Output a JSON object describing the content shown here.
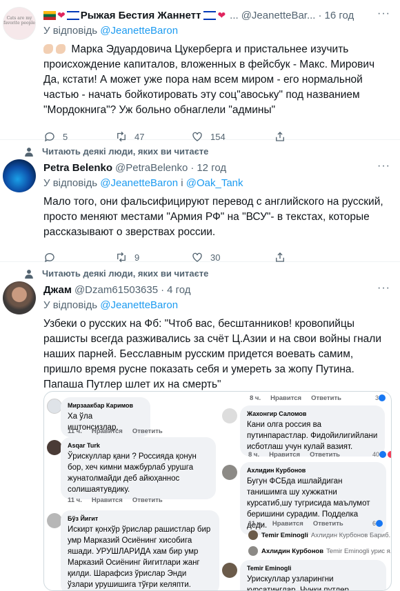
{
  "tweets": [
    {
      "name": "Рыжая Бестия Жаннетт",
      "handle": "@JeanetteBar...",
      "time": "16 год",
      "reply_prefix": "У відповідь",
      "reply_to": "@JeanetteBaron",
      "text": "Марка Эдуардовича Цукерберга и пристальнее изучить происхождение капиталов, вложенных в фейсбук - Макс. Мирович Да, кстати! А может уже пора нам всем миром - его нормальной частью - начать бойкотировать эту соц\"авоську\" под названием \"Мордокнига\"? Уж больно обнаглели \"админы\"",
      "replies": "5",
      "retweets": "47",
      "likes": "154",
      "avatar_text": "Cats are my favorite people"
    },
    {
      "social": "Читають деякі люди, яких ви читаєте",
      "name": "Petra Belenko",
      "handle": "@PetraBelenko",
      "time": "12 год",
      "reply_prefix": "У відповідь",
      "reply_to": "@JeanetteBaron",
      "reply_and": "і",
      "reply_to2": "@Oak_Tank",
      "text": "Мало того, они фальсифицируют перевод с английского на русский, просто меняют местами \"Армия РФ\" на \"ВСУ\"- в текстах, которые рассказывают о зверствах россии.",
      "replies": "",
      "retweets": "9",
      "likes": "30"
    },
    {
      "social": "Читають деякі люди, яких ви читаєте",
      "name": "Джам",
      "handle": "@Dzam61503635",
      "time": "4 год",
      "reply_prefix": "У відповідь",
      "reply_to": "@JeanetteBaron",
      "text": "Узбеки о русских на Фб: \"Чтоб вас, бесштанников!  кровопийцы рашисты всегда разживались за счёт Ц.Азии и на свои войны гнали наших парней. Бесславным русским придется воевать самим, пришло время русне показать себя и умереть за жопу Путина. Папаша Путлер шлет их на смерть\""
    }
  ],
  "media": {
    "left": [
      {
        "author": "Мирзаакбар Каримов",
        "text": "Ха ўла иштонсизлар.",
        "age": "11 ч.",
        "like": "Нравится",
        "reply": "Ответить"
      },
      {
        "author": "Asqar Turk",
        "text": "Ўрискуллар қани ? Россияда қонун бор, хеч кимни мажбурлаб урушга жунатолмайди деб айюҳаннос солишаятувдику.",
        "age": "11 ч.",
        "like": "Нравится",
        "reply": "Ответить"
      },
      {
        "author": "Бўз Йигит",
        "text": "Искирт қонхўр ўрислар рашистлар бир умр Марказий Осиёнинг хисобига яшади.  УРУШЛАРИДА  хам бир умр Марказий Осиёнинг йигитлари жанг қилди.  Шарафсиз ўрислар Энди ўзлари урушишига тўғри келяпти."
      }
    ],
    "right": [
      {
        "age": "8 ч.",
        "like": "Нравится",
        "reply": "Ответить",
        "count": "3"
      },
      {
        "author": "Жахонгир Саломов",
        "text": "Кани олга россия ва путинпарастлар. Фидойилигийлани исботлаш учун кулай вазият.",
        "age": "8 ч.",
        "like": "Нравится",
        "reply": "Ответить",
        "count": "40"
      },
      {
        "author": "Ахлидин Курбонов",
        "text": "Бугун ФСБда ишлайдиган танишимга шу хужжатни курсатиб,шу тугрисида маълумот беришини сурадим. Подделка деди.",
        "age": "11 ч.",
        "like": "Нравится",
        "reply": "Ответить",
        "count": "6"
      },
      {
        "name": "Temir Eminogli",
        "rest": "Ахлидин Курбонов Бариб..."
      },
      {
        "name": "Ахлидин Курбонов",
        "rest": "Temir Eminogli урис я..."
      },
      {
        "author": "Temir Eminogli",
        "text": "Урискуллар узларингни курсатинглар. Чунки путлер"
      }
    ]
  },
  "colors": {
    "link": "#1d9bf0",
    "muted": "#536471",
    "accent_heart": "#e0245e"
  }
}
